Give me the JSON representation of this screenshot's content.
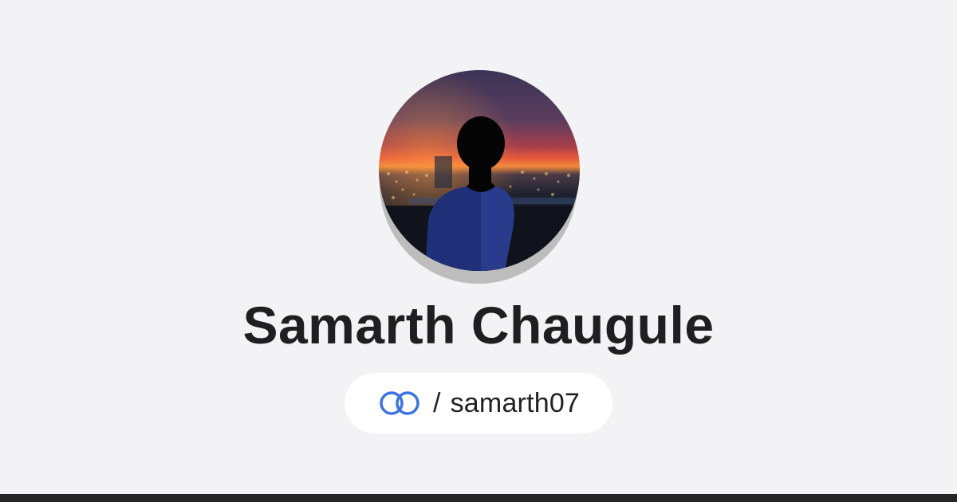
{
  "profile": {
    "name": "Samarth Chaugule",
    "separator": "/",
    "username": "samarth07"
  },
  "icons": {
    "avatar": "profile-photo-silhouette-sunset",
    "link": "interlinked-rings-icon"
  },
  "colors": {
    "background": "#f3f3f6",
    "accent": "#3b73e0",
    "name_text": "#1f1f22",
    "pill_background": "#ffffff",
    "bottom_bar": "#262626"
  }
}
